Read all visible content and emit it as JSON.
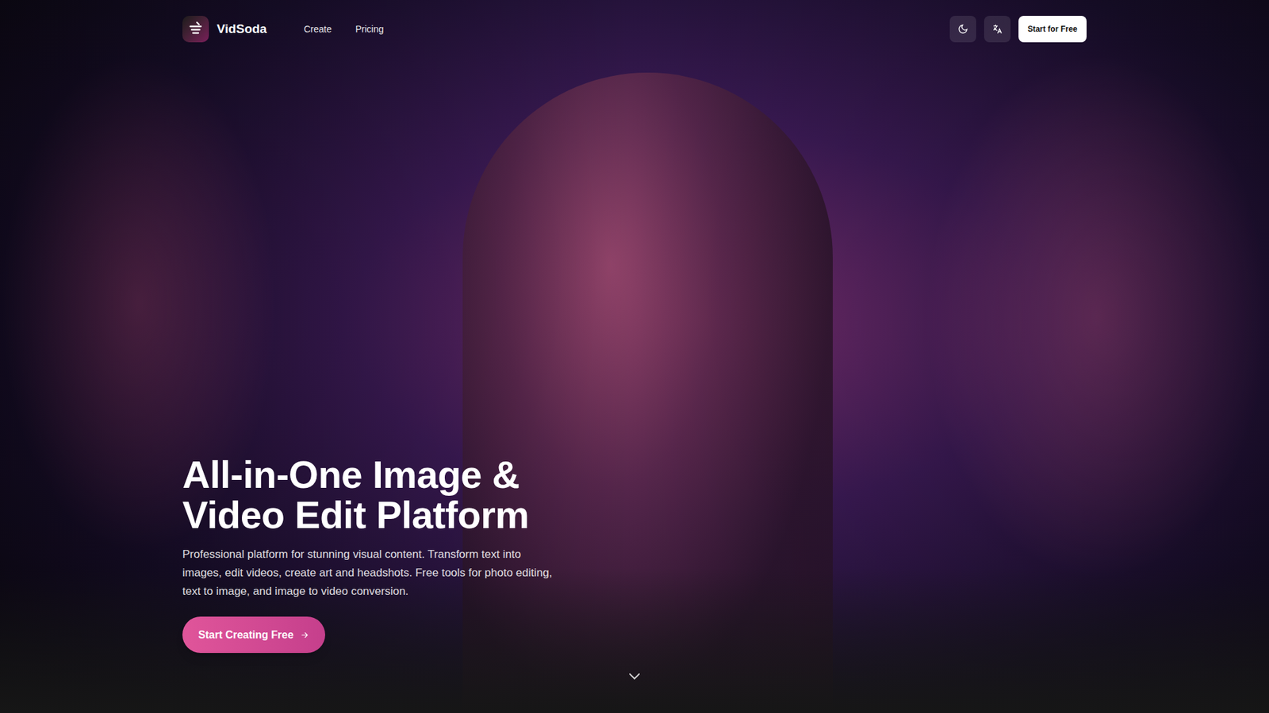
{
  "nav": {
    "brand": "VidSoda",
    "links": [
      "Create",
      "Pricing"
    ],
    "cta": "Start for Free"
  },
  "hero": {
    "title_lines": [
      "All-in-One Image &",
      "Video Edit Platform"
    ],
    "description": "Professional platform for stunning visual content. Transform text into images, edit videos, create art and headshots. Free tools for photo editing, text to image, and image to video conversion.",
    "cta": "Start Creating Free"
  }
}
